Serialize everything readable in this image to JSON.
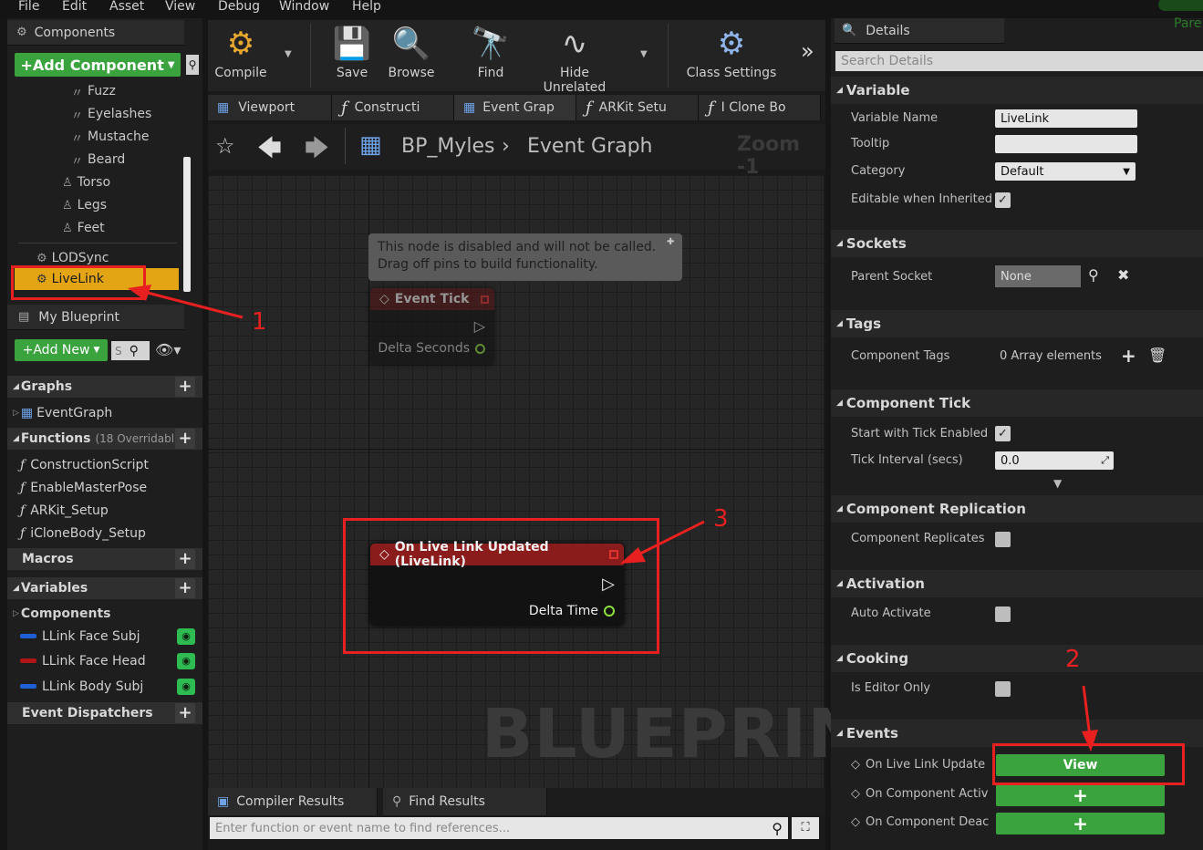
{
  "menu": [
    "File",
    "Edit",
    "Asset",
    "View",
    "Debug",
    "Window",
    "Help"
  ],
  "components_panel": {
    "title": "Components",
    "add_component_label": "+Add Component",
    "items": [
      "Fuzz",
      "Eyelashes",
      "Mustache",
      "Beard",
      "Torso",
      "Legs",
      "Feet",
      "LODSync",
      "LiveLink"
    ]
  },
  "my_blueprint": {
    "title": "My Blueprint",
    "add_new_label": "+Add New",
    "search_placeholder": "S",
    "graphs_label": "Graphs",
    "graph_items": [
      "EventGraph"
    ],
    "functions_label": "Functions",
    "functions_count": "(18 Overridabl",
    "function_items": [
      "ConstructionScript",
      "EnableMasterPose",
      "ARKit_Setup",
      "iCloneBody_Setup"
    ],
    "macros_label": "Macros",
    "variables_label": "Variables",
    "components_label": "Components",
    "variable_items": [
      {
        "name": "LLink Face Subj",
        "color": "#1f5fd6"
      },
      {
        "name": "LLink Face Head",
        "color": "#b01515"
      },
      {
        "name": "LLink Body Subj",
        "color": "#1f5fd6"
      }
    ],
    "event_dispatchers_label": "Event Dispatchers"
  },
  "toolbar": {
    "compile": "Compile",
    "save": "Save",
    "browse": "Browse",
    "find": "Find",
    "hide_unrelated": "Hide Unrelated",
    "class_settings": "Class Settings"
  },
  "doc_tabs": [
    "Viewport",
    "Constructi",
    "Event Grap",
    "ARKit Setu",
    "I Clone Bo"
  ],
  "breadcrumb": {
    "blueprint": "BP_Myles",
    "graph": "Event Graph",
    "zoom": "Zoom -1"
  },
  "graph": {
    "comment": "This node is disabled and will not be called.\nDrag off pins to build functionality.",
    "event_tick_title": "Event Tick",
    "event_tick_pin": "Delta Seconds",
    "live_link_title": "On Live Link Updated (LiveLink)",
    "live_link_pin": "Delta Time",
    "watermark": "BLUEPRINT"
  },
  "bottom": {
    "compiler_results": "Compiler Results",
    "find_results": "Find Results",
    "find_placeholder": "Enter function or event name to find references..."
  },
  "details": {
    "title": "Details",
    "search_placeholder": "Search Details",
    "corner_label": "Pare",
    "categories": {
      "variable": "Variable",
      "sockets": "Sockets",
      "tags": "Tags",
      "component_tick": "Component Tick",
      "component_replication": "Component Replication",
      "activation": "Activation",
      "cooking": "Cooking",
      "events": "Events"
    },
    "props": {
      "variable_name_label": "Variable Name",
      "variable_name_value": "LiveLink",
      "tooltip_label": "Tooltip",
      "category_label": "Category",
      "category_value": "Default",
      "editable_label": "Editable when Inherited",
      "parent_socket_label": "Parent Socket",
      "parent_socket_value": "None",
      "component_tags_label": "Component Tags",
      "component_tags_value": "0 Array elements",
      "start_tick_label": "Start with Tick Enabled",
      "tick_interval_label": "Tick Interval (secs)",
      "tick_interval_value": "0.0",
      "replicates_label": "Component Replicates",
      "auto_activate_label": "Auto Activate",
      "editor_only_label": "Is Editor Only"
    },
    "events": [
      {
        "label": "On Live Link Update",
        "button": "View"
      },
      {
        "label": "On Component Activ",
        "button": "+"
      },
      {
        "label": "On Component Deac",
        "button": "+"
      }
    ]
  },
  "annotations": [
    "1",
    "2",
    "3"
  ]
}
